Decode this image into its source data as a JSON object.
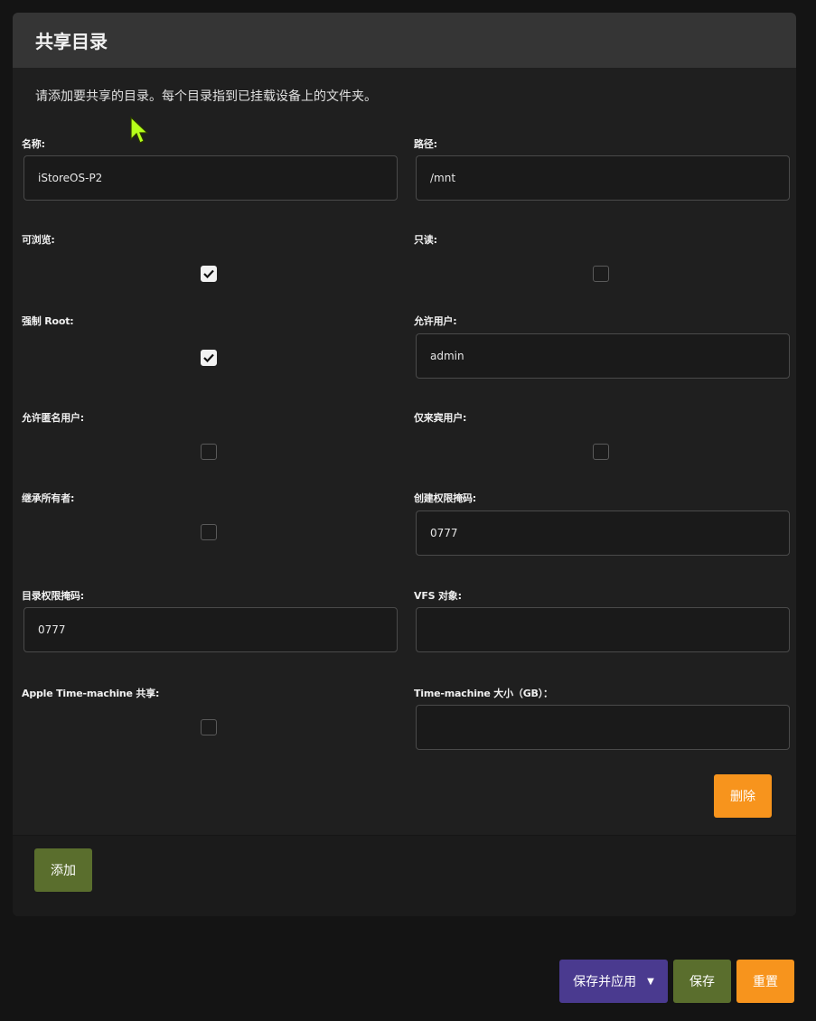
{
  "panel": {
    "title": "共享目录",
    "description": "请添加要共享的目录。每个目录指到已挂载设备上的文件夹。"
  },
  "fields": {
    "name": {
      "label": "名称:",
      "value": "iStoreOS-P2"
    },
    "path": {
      "label": "路径:",
      "value": "/mnt"
    },
    "browseable": {
      "label": "可浏览:",
      "checked": true
    },
    "read_only": {
      "label": "只读:",
      "checked": false
    },
    "force_root": {
      "label": "强制 Root:",
      "checked": true
    },
    "allowed_users": {
      "label": "允许用户:",
      "value": "admin"
    },
    "allow_guests": {
      "label": "允许匿名用户:",
      "checked": false
    },
    "guest_only": {
      "label": "仅来宾用户:",
      "checked": false
    },
    "inherit_owner": {
      "label": "继承所有者:",
      "checked": false
    },
    "create_mask": {
      "label": "创建权限掩码:",
      "value": "0777"
    },
    "dir_mask": {
      "label": "目录权限掩码:",
      "value": "0777"
    },
    "vfs_objects": {
      "label": "VFS 对象:",
      "value": ""
    },
    "timemachine": {
      "label": "Apple Time-machine 共享:",
      "checked": false
    },
    "timemachine_size": {
      "label": "Time-machine 大小（GB）：",
      "value": ""
    }
  },
  "buttons": {
    "delete": "删除",
    "add": "添加",
    "save_apply": "保存并应用",
    "save": "保存",
    "reset": "重置"
  }
}
